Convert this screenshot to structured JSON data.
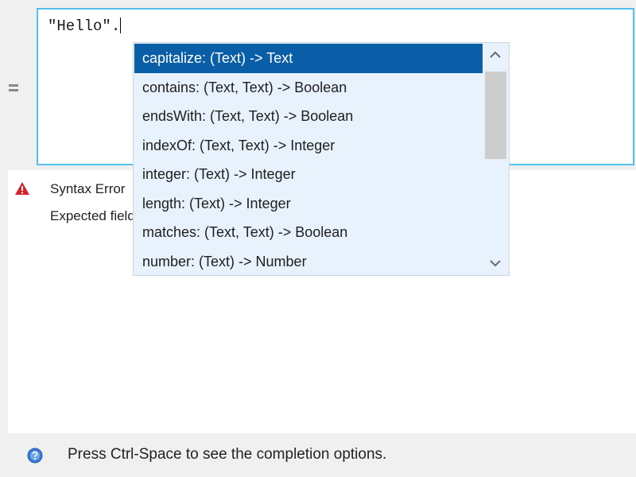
{
  "editor": {
    "text": "\"Hello\"."
  },
  "errors": {
    "line1": "Syntax Error",
    "line2": "Expected field or method"
  },
  "completion": {
    "selected_index": 0,
    "items": [
      "capitalize: (Text) -> Text",
      "contains: (Text, Text) -> Boolean",
      "endsWith: (Text, Text) -> Boolean",
      "indexOf: (Text, Text) -> Integer",
      "integer: (Text) -> Integer",
      "length: (Text) -> Integer",
      "matches: (Text, Text) -> Boolean",
      "number: (Text) -> Number"
    ]
  },
  "status": {
    "message": "Press Ctrl-Space to see the completion options."
  },
  "icons": {
    "equals": "equals-icon",
    "warning": "warning-icon",
    "help": "help-icon",
    "scroll_up": "chevron-up-icon",
    "scroll_down": "chevron-down-icon"
  },
  "colors": {
    "editor_border": "#54c0eb",
    "selection": "#0a5ea8",
    "popup_background": "#e8f2fc",
    "warning_red": "#d8232a",
    "help_blue": "#3a7bd5"
  }
}
